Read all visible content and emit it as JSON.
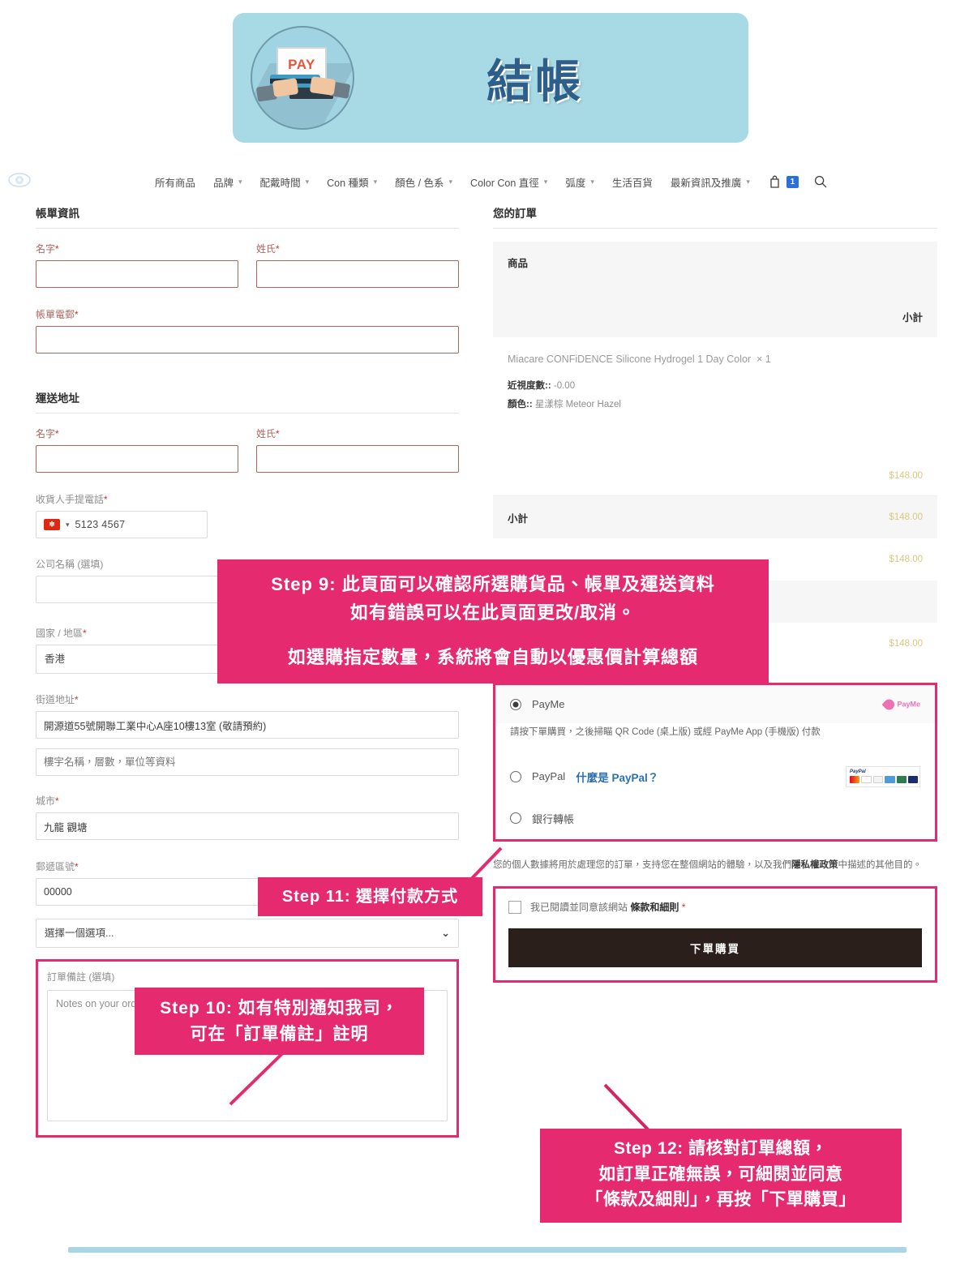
{
  "hero": {
    "title": "結帳",
    "badge_text": "PAY",
    "badge_icon": "payment-terminal-icon"
  },
  "nav": {
    "logo_icon": "eye-lens-logo-icon",
    "items": [
      {
        "label": "所有商品",
        "has_caret": false
      },
      {
        "label": "品牌",
        "has_caret": true
      },
      {
        "label": "配戴時間",
        "has_caret": true
      },
      {
        "label": "Con 種類",
        "has_caret": true
      },
      {
        "label": "顏色 / 色系",
        "has_caret": true
      },
      {
        "label": "Color Con 直徑",
        "has_caret": true
      },
      {
        "label": "弧度",
        "has_caret": true
      },
      {
        "label": "生活百貨",
        "has_caret": false
      },
      {
        "label": "最新資訊及推廣",
        "has_caret": true
      }
    ],
    "cart_icon": "shopping-bag-icon",
    "cart_count": "1",
    "search_icon": "search-icon"
  },
  "billing": {
    "section_title": "帳單資訊",
    "first_name_label": "名字",
    "first_name_value": "",
    "last_name_label": "姓氏",
    "last_name_value": "",
    "email_label": "帳單電郵",
    "email_value": "",
    "required_mark": "*"
  },
  "shipping": {
    "section_title": "運送地址",
    "first_name_label": "名字",
    "first_name_value": "",
    "last_name_label": "姓氏",
    "last_name_value": "",
    "phone_label": "收貨人手提電話",
    "phone_country_icon": "hong-kong-flag-icon",
    "phone_value": "5123 4567",
    "company_label": "公司名稱 (選填)",
    "company_value": "",
    "country_label": "國家 / 地區",
    "country_value": "香港",
    "street_label": "街道地址",
    "street_value": "開源道55號開聯工業中心A座10樓13室 (敬請預約)",
    "apt_value": "",
    "apt_placeholder": "樓宇名稱，層數，單位等資料",
    "city_label": "城市",
    "city_value": "九龍 觀塘",
    "postcode_label": "郵遞區號",
    "postcode_value": "00000",
    "district_value": "選擇一個選項...",
    "notes_label": "訂單備註 (選填)",
    "notes_placeholder": "Notes on your order, e.g. special notes concerning delivery.",
    "notes_value": ""
  },
  "order": {
    "section_title": "您的訂單",
    "col_product": "商品",
    "col_subtotal": "小計",
    "items": [
      {
        "name": "Miacare CONFiDENCE Silicone Hydrogel 1 Day Color",
        "qty": "× 1",
        "meta": [
          {
            "key": "近視度數::",
            "value": "-0.00"
          },
          {
            "key": "顏色::",
            "value": "星漾棕 Meteor Hazel"
          }
        ],
        "price": "$148.00"
      }
    ],
    "rows": [
      {
        "label": "小計",
        "value": "$148.00",
        "shaded": true
      },
      {
        "label": "",
        "value": "$148.00",
        "shaded": false
      },
      {
        "label": "",
        "value": "",
        "shaded": true
      },
      {
        "label": "",
        "value": "$148.00",
        "shaded": false
      }
    ]
  },
  "payment": {
    "options": [
      {
        "label": "PayMe",
        "selected": true,
        "logo": "payme-logo-icon"
      },
      {
        "label": "PayPal",
        "extra": "什麼是 PayPal？",
        "selected": false,
        "logo": "paypal-cards-icon"
      },
      {
        "label": "銀行轉帳",
        "selected": false,
        "logo": ""
      }
    ],
    "payme_note": "請按下單購買，之後掃瞄 QR Code (桌上版) 或經 PayMe App (手機版) 付款",
    "payme_logo_text": "PayMe",
    "paypal_logo_text": "PayPal"
  },
  "privacy": {
    "text_1": "您的個人數據將用於處理您的訂單，支持您在整個網站的體驗，以及我們",
    "link": "隱私權政策",
    "text_2": "中描述的其他目的。"
  },
  "terms": {
    "text_1": "我已閱讀並同意該網站",
    "link": "條款和細則",
    "required_mark": "*",
    "checked": false,
    "submit_label": "下單購買"
  },
  "callouts": {
    "step9": {
      "line1": "Step 9: 此頁面可以確認所選購貨品、帳單及運送資料",
      "line2": "如有錯誤可以在此頁面更改/取消。",
      "line3": "如選購指定數量，系統將會自動以優惠價計算總額"
    },
    "step10": {
      "line1": "Step 10: 如有特別通知我司，",
      "line2": "可在「訂單備註」註明"
    },
    "step11": {
      "line1": "Step 11: 選擇付款方式"
    },
    "step12": {
      "line1": "Step 12: 請核對訂單總額，",
      "line2": "如訂單正確無誤，可細閱並同意",
      "line3": "「條款及細則」，再按「下單購買」"
    }
  },
  "colors": {
    "hero_bg": "#a8dae6",
    "hero_title": "#2e5f8a",
    "callout_pink": "#e52a6f",
    "price_gold": "#d9c87f",
    "label_red": "#a8685f",
    "submit_dark": "#2a1f1b",
    "cart_badge_blue": "#2d6fd8",
    "bottom_bar_blue": "#a9d6e5"
  }
}
